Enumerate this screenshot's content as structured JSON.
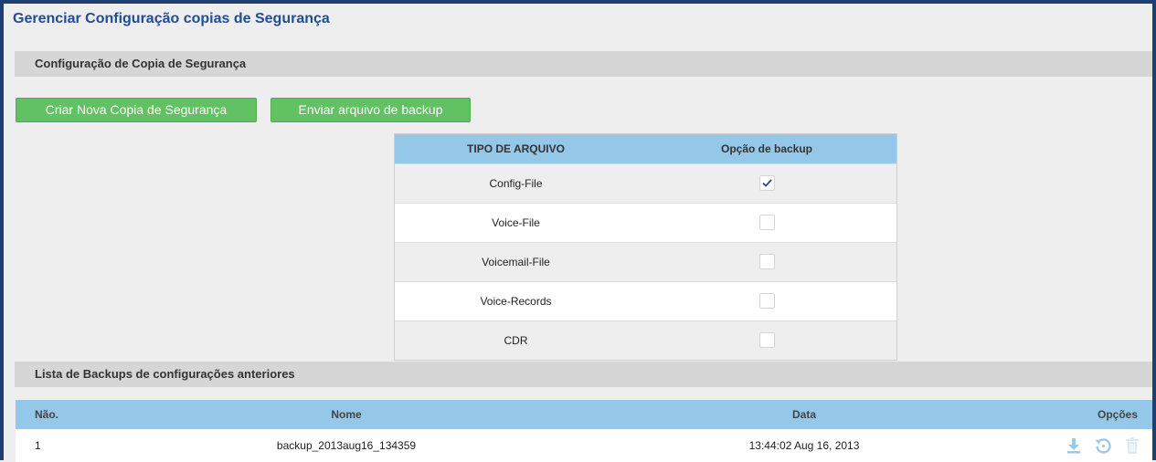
{
  "page": {
    "title": "Gerenciar Configuração copias de Segurança"
  },
  "config_section": {
    "title": "Configuração de Copia de Segurança"
  },
  "buttons": {
    "create": "Criar Nova Copia de Segurança",
    "upload": "Enviar arquivo de backup"
  },
  "file_table": {
    "headers": {
      "type": "TIPO DE ARQUIVO",
      "option": "Opção de backup"
    },
    "rows": [
      {
        "type": "Config-File",
        "checked": true
      },
      {
        "type": "Voice-File",
        "checked": false
      },
      {
        "type": "Voicemail-File",
        "checked": false
      },
      {
        "type": "Voice-Records",
        "checked": false
      },
      {
        "type": "CDR",
        "checked": false
      }
    ]
  },
  "list_section": {
    "title": "Lista de Backups de configurações anteriores"
  },
  "backup_list": {
    "headers": {
      "no": "Não.",
      "name": "Nome",
      "date": "Data",
      "options": "Opções"
    },
    "rows": [
      {
        "no": "1",
        "name": "backup_2013aug16_134359",
        "date": "13:44:02 Aug 16, 2013"
      }
    ]
  },
  "icons": {
    "download": "download-icon",
    "restore": "restore-icon",
    "delete": "trash-icon"
  },
  "colors": {
    "title": "#1f4e94",
    "green_button": "#62c163",
    "table_header": "#95c8e8",
    "section_bar": "#d6d6d6",
    "icon": "#9cc9e6",
    "frame": "#1e3f73"
  }
}
